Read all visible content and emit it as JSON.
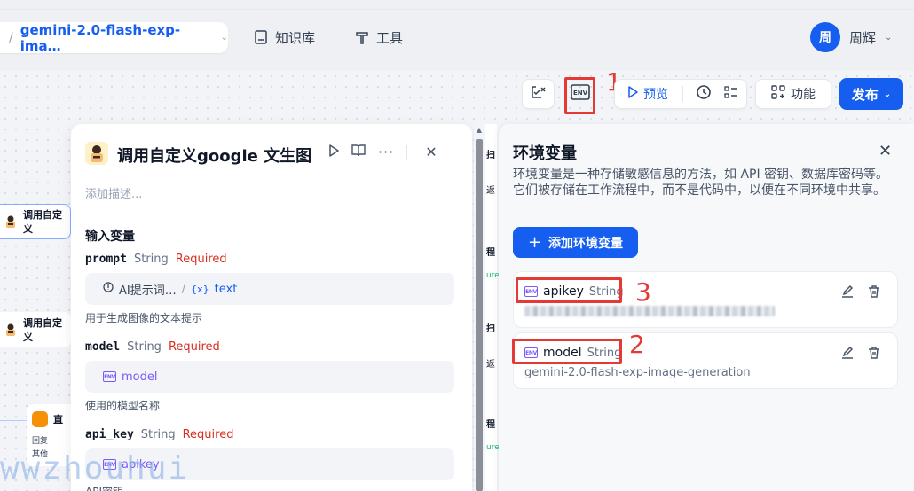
{
  "header": {
    "app_name": "gemini-2.0-flash-exp-ima…",
    "nav": [
      {
        "label": "知识库",
        "icon": "book-icon"
      },
      {
        "label": "工具",
        "icon": "tool-icon"
      }
    ],
    "user": {
      "avatar": "周",
      "name": "周辉"
    }
  },
  "toolbar": {
    "preview_label": "预览",
    "features_label": "功能",
    "publish_label": "发布"
  },
  "annotations": {
    "env_button": "1",
    "model_row": "2",
    "apikey_row": "3"
  },
  "canvas_nodes": [
    {
      "label": "调用自定义"
    },
    {
      "label": "调用自定义"
    },
    {
      "label": "直",
      "sub1": "回复",
      "sub2": "其他"
    }
  ],
  "node_panel": {
    "title": "调用自定义google 文生图",
    "description_placeholder": "添加描述...",
    "section": "输入变量",
    "vars": [
      {
        "name": "prompt",
        "type": "String",
        "required": "Required",
        "ref_node": "AI提示词…",
        "ref_sep": "/",
        "ref_var": "text",
        "help": "用于生成图像的文本提示"
      },
      {
        "name": "model",
        "type": "String",
        "required": "Required",
        "ref_var": "model",
        "help": "使用的模型名称"
      },
      {
        "name": "api_key",
        "type": "String",
        "required": "Required",
        "ref_var": "apikey",
        "help": "API密钥"
      }
    ]
  },
  "env_panel": {
    "title": "环境变量",
    "description": "环境变量是一种存储敏感信息的方法，如 API 密钥、数据库密码等。它们被存储在工作流程中，而不是代码中，以便在不同环境中共享。",
    "add_label": "添加环境变量",
    "vars": [
      {
        "name": "apikey",
        "type": "String",
        "value": ""
      },
      {
        "name": "model",
        "type": "String",
        "value": "gemini-2.0-flash-exp-image-generation"
      }
    ]
  },
  "mid_strip": {
    "a": "扫",
    "b": "返",
    "c": "程",
    "d": "ure",
    "e": "扫",
    "f": "返",
    "g": "程",
    "h": "ure"
  },
  "watermark": "wwzhouhui",
  "colors": {
    "primary": "#155eef",
    "required": "#d92d20",
    "env": "#7a5af8",
    "annotation": "#e53935"
  }
}
